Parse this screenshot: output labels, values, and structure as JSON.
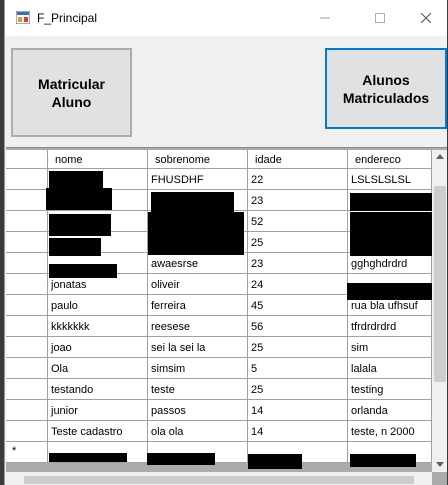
{
  "window": {
    "title": "F_Principal"
  },
  "buttons": {
    "matricular": "Matricular\nAluno",
    "alunos": "Alunos\nMatriculados"
  },
  "grid": {
    "columns": [
      "nome",
      "sobrenome",
      "idade",
      "endereco"
    ],
    "rows": [
      [
        "",
        "FHUSDHF",
        "22",
        "LSLSLSLSL"
      ],
      [
        "",
        "",
        "23",
        ""
      ],
      [
        "",
        "",
        "52",
        ""
      ],
      [
        "",
        "",
        "25",
        ""
      ],
      [
        "",
        "awaesrse",
        "23",
        "gghghdrdrd"
      ],
      [
        "jonatas",
        "oliveir",
        "24",
        ""
      ],
      [
        "paulo",
        "ferreira",
        "45",
        "rua bla ufhsuf"
      ],
      [
        "kkkkkkk",
        "reesese",
        "56",
        "tfrdrdrdrd"
      ],
      [
        "joao",
        "sei la sei la",
        "25",
        "sim"
      ],
      [
        "Ola",
        "simsim",
        "5",
        "lalala"
      ],
      [
        "testando",
        "teste",
        "25",
        "testing"
      ],
      [
        "junior",
        "passos",
        "14",
        "orlanda"
      ],
      [
        "Teste cadastro",
        "ola ola",
        "14",
        "teste, n 2000"
      ]
    ],
    "new_row_marker": "*"
  },
  "icons": {
    "app": "app-icon",
    "minimize": "minimize-icon",
    "maximize": "maximize-icon",
    "close": "close-icon"
  },
  "colors": {
    "focus_border": "#0078d7",
    "redaction": "#000000"
  }
}
